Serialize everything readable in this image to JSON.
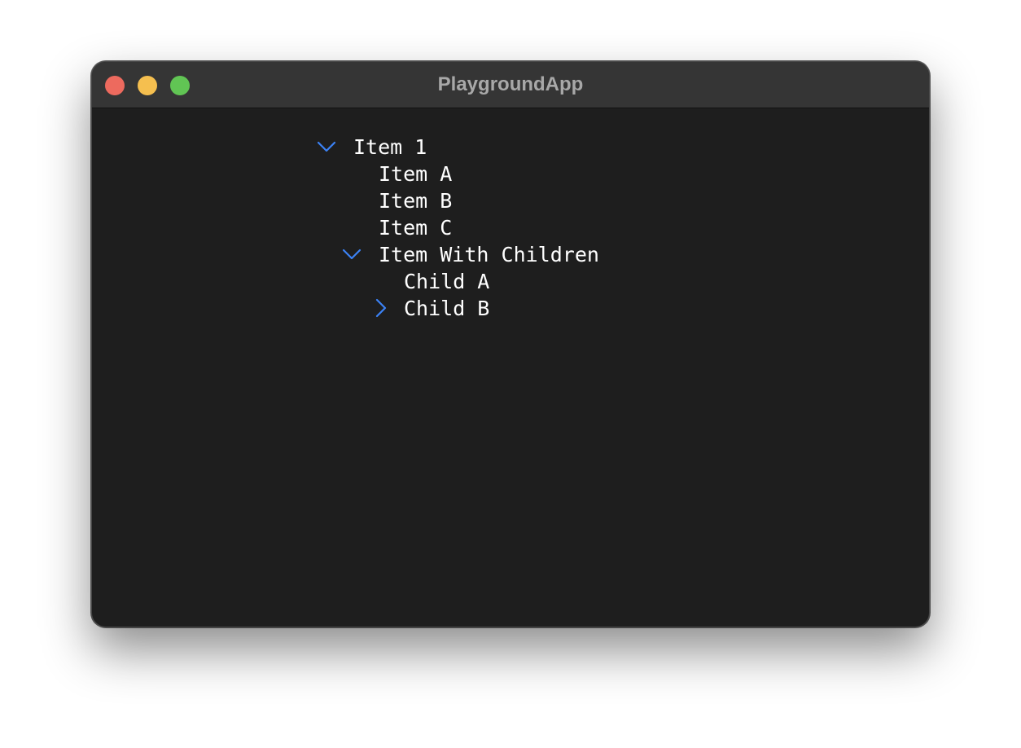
{
  "window": {
    "title": "PlaygroundApp"
  },
  "tree": {
    "item1": {
      "label": "Item 1",
      "expanded": true
    },
    "item_a": {
      "label": "Item A"
    },
    "item_b": {
      "label": "Item B"
    },
    "item_c": {
      "label": "Item C"
    },
    "item_with_children": {
      "label": "Item With Children",
      "expanded": true
    },
    "child_a": {
      "label": "Child A"
    },
    "child_b": {
      "label": "Child B",
      "expanded": false
    }
  },
  "colors": {
    "accent": "#3b82f6",
    "window_bg": "#1e1e1e",
    "titlebar_bg": "#353535",
    "close": "#ed6a5e",
    "minimize": "#f5bf4f",
    "maximize": "#61c554"
  }
}
